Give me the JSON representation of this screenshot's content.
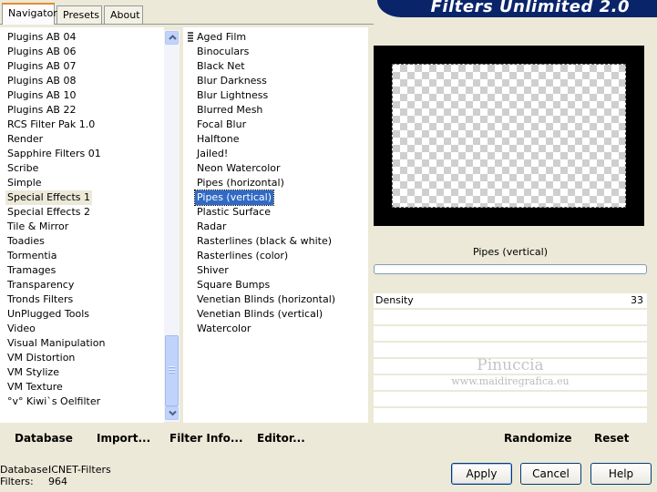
{
  "tabs": [
    "Navigator",
    "Presets",
    "About"
  ],
  "banner": "Filters Unlimited 2.0",
  "categories": [
    "Plugins AB 04",
    "Plugins AB 06",
    "Plugins AB 07",
    "Plugins AB 08",
    "Plugins AB 10",
    "Plugins AB 22",
    "RCS Filter Pak 1.0",
    "Render",
    "Sapphire Filters 01",
    "Scribe",
    "Simple",
    "Special Effects 1",
    "Special Effects 2",
    "Tile & Mirror",
    "Toadies",
    "Tormentia",
    "Tramages",
    "Transparency",
    "Tronds Filters",
    "UnPlugged Tools",
    "Video",
    "Visual Manipulation",
    "VM Distortion",
    "VM Stylize",
    "VM Texture",
    "°v° Kiwi`s Oelfilter"
  ],
  "selected_category": "Special Effects 1",
  "filters": [
    "Aged Film",
    "Binoculars",
    "Black Net",
    "Blur Darkness",
    "Blur Lightness",
    "Blurred Mesh",
    "Focal Blur",
    "Halftone",
    "Jailed!",
    "Neon Watercolor",
    "Pipes (horizontal)",
    "Pipes (vertical)",
    "Plastic Surface",
    "Radar",
    "Rasterlines (black & white)",
    "Rasterlines (color)",
    "Shiver",
    "Square Bumps",
    "Venetian Blinds (horizontal)",
    "Venetian Blinds (vertical)",
    "Watercolor"
  ],
  "selected_filter": "Pipes (vertical)",
  "filter_title": "Pipes (vertical)",
  "param": {
    "label": "Density",
    "value": "33"
  },
  "watermark": {
    "name": "Pinuccia",
    "url": "www.maidiregrafica.eu"
  },
  "footer_links": {
    "database": "Database",
    "import": "Import...",
    "filter_info": "Filter Info...",
    "editor": "Editor..."
  },
  "actions": {
    "randomize": "Randomize",
    "reset": "Reset"
  },
  "status": {
    "database_label": "Database:",
    "database_value": "ICNET-Filters",
    "filters_label": "Filters:",
    "filters_value": "964"
  },
  "buttons": {
    "apply": "Apply",
    "cancel": "Cancel",
    "help": "Help"
  }
}
